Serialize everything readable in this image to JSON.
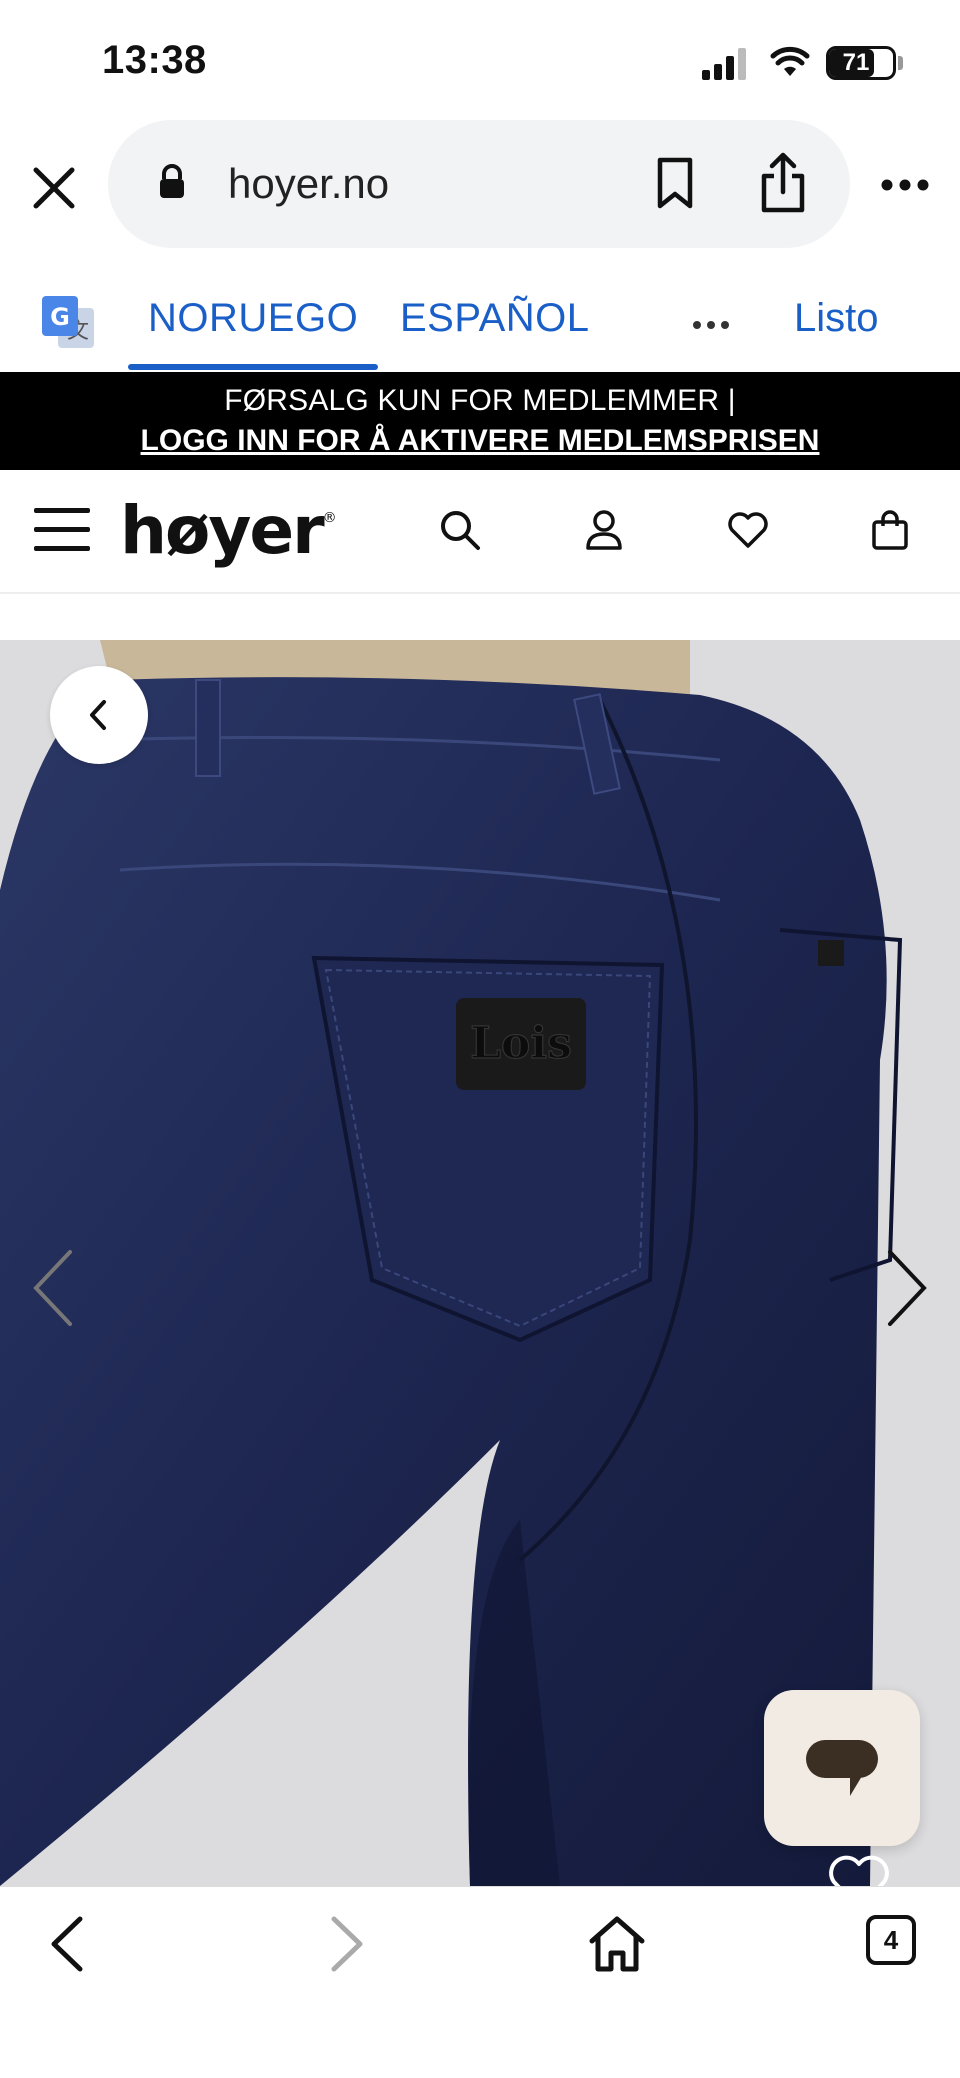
{
  "status_bar": {
    "time": "13:38",
    "battery_level": "71",
    "battery_fraction": 0.71,
    "icons": [
      "signal-icon",
      "wifi-icon",
      "battery-icon"
    ]
  },
  "browser": {
    "url": "hoyer.no",
    "icons": [
      "close-icon",
      "lock-icon",
      "bookmark-icon",
      "share-icon",
      "more-icon"
    ]
  },
  "translate_bar": {
    "source_language": "NORUEGO",
    "target_language": "ESPAÑOL",
    "selected": "source",
    "done_label": "Listo",
    "accent_color": "#1a5fc8"
  },
  "promo_banner": {
    "line1": "FØRSALG KUN FOR MEDLEMMER |",
    "link_text": "LOGG INN FOR Å AKTIVERE MEDLEMSPRISEN"
  },
  "site_header": {
    "logo": "høyer",
    "logo_mark": "®",
    "icons": [
      "menu-icon",
      "search-icon",
      "account-icon",
      "wishlist-icon",
      "cart-icon"
    ]
  },
  "product_gallery": {
    "image_subject": "dark blue jeans, back pocket view",
    "patch_brand": "Lois",
    "icons": [
      "back-arrow-icon",
      "prev-arrow-icon",
      "next-arrow-icon",
      "chat-icon",
      "heart-icon"
    ]
  },
  "bottom_toolbar": {
    "tabs_count": "4",
    "icons": [
      "back-icon",
      "forward-icon",
      "home-icon",
      "tabs-icon"
    ]
  }
}
